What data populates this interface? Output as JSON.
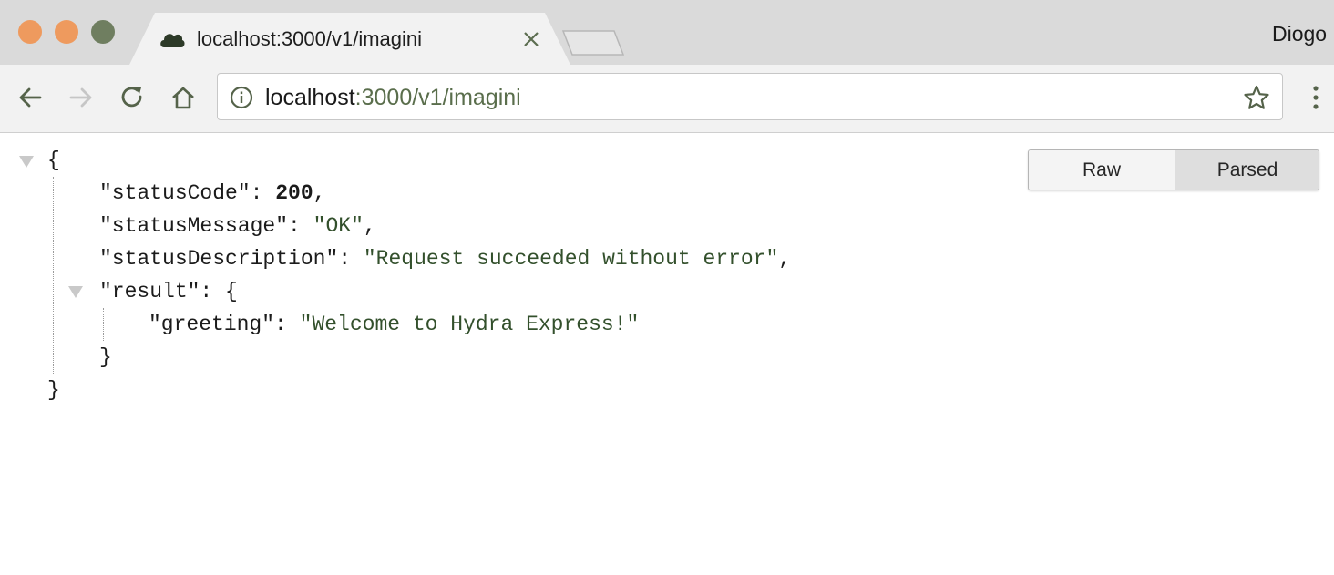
{
  "window": {
    "tab_title": "localhost:3000/v1/imagini",
    "profile_name": "Diogo"
  },
  "toolbar": {
    "url_host": "localhost",
    "url_rest": ":3000/v1/imagini"
  },
  "viewer": {
    "mode_raw": "Raw",
    "mode_parsed": "Parsed",
    "selected_mode": "Parsed",
    "lines": {
      "open_root": "{",
      "status_code_key": "\"statusCode\"",
      "status_code_value": "200",
      "status_message_key": "\"statusMessage\"",
      "status_message_value": "\"OK\"",
      "status_description_key": "\"statusDescription\"",
      "status_description_value": "\"Request succeeded without error\"",
      "result_key": "\"result\"",
      "result_open": "{",
      "greeting_key": "\"greeting\"",
      "greeting_value": "\"Welcome to Hydra Express!\"",
      "result_close": "}",
      "close_root": "}"
    }
  },
  "icons": {
    "favicon": "cloud-icon",
    "close_tab": "close-icon",
    "back": "arrow-left-icon",
    "forward": "arrow-right-icon",
    "reload": "reload-icon",
    "home": "home-icon",
    "info": "info-icon",
    "bookmark": "star-icon",
    "menu": "kebab-menu-icon"
  },
  "colors": {
    "json_string": "#33502c",
    "url_path": "#5a6e4c",
    "traffic_close": "#ee9a5e",
    "traffic_min": "#ee9a5e",
    "traffic_max": "#6f7e60"
  }
}
